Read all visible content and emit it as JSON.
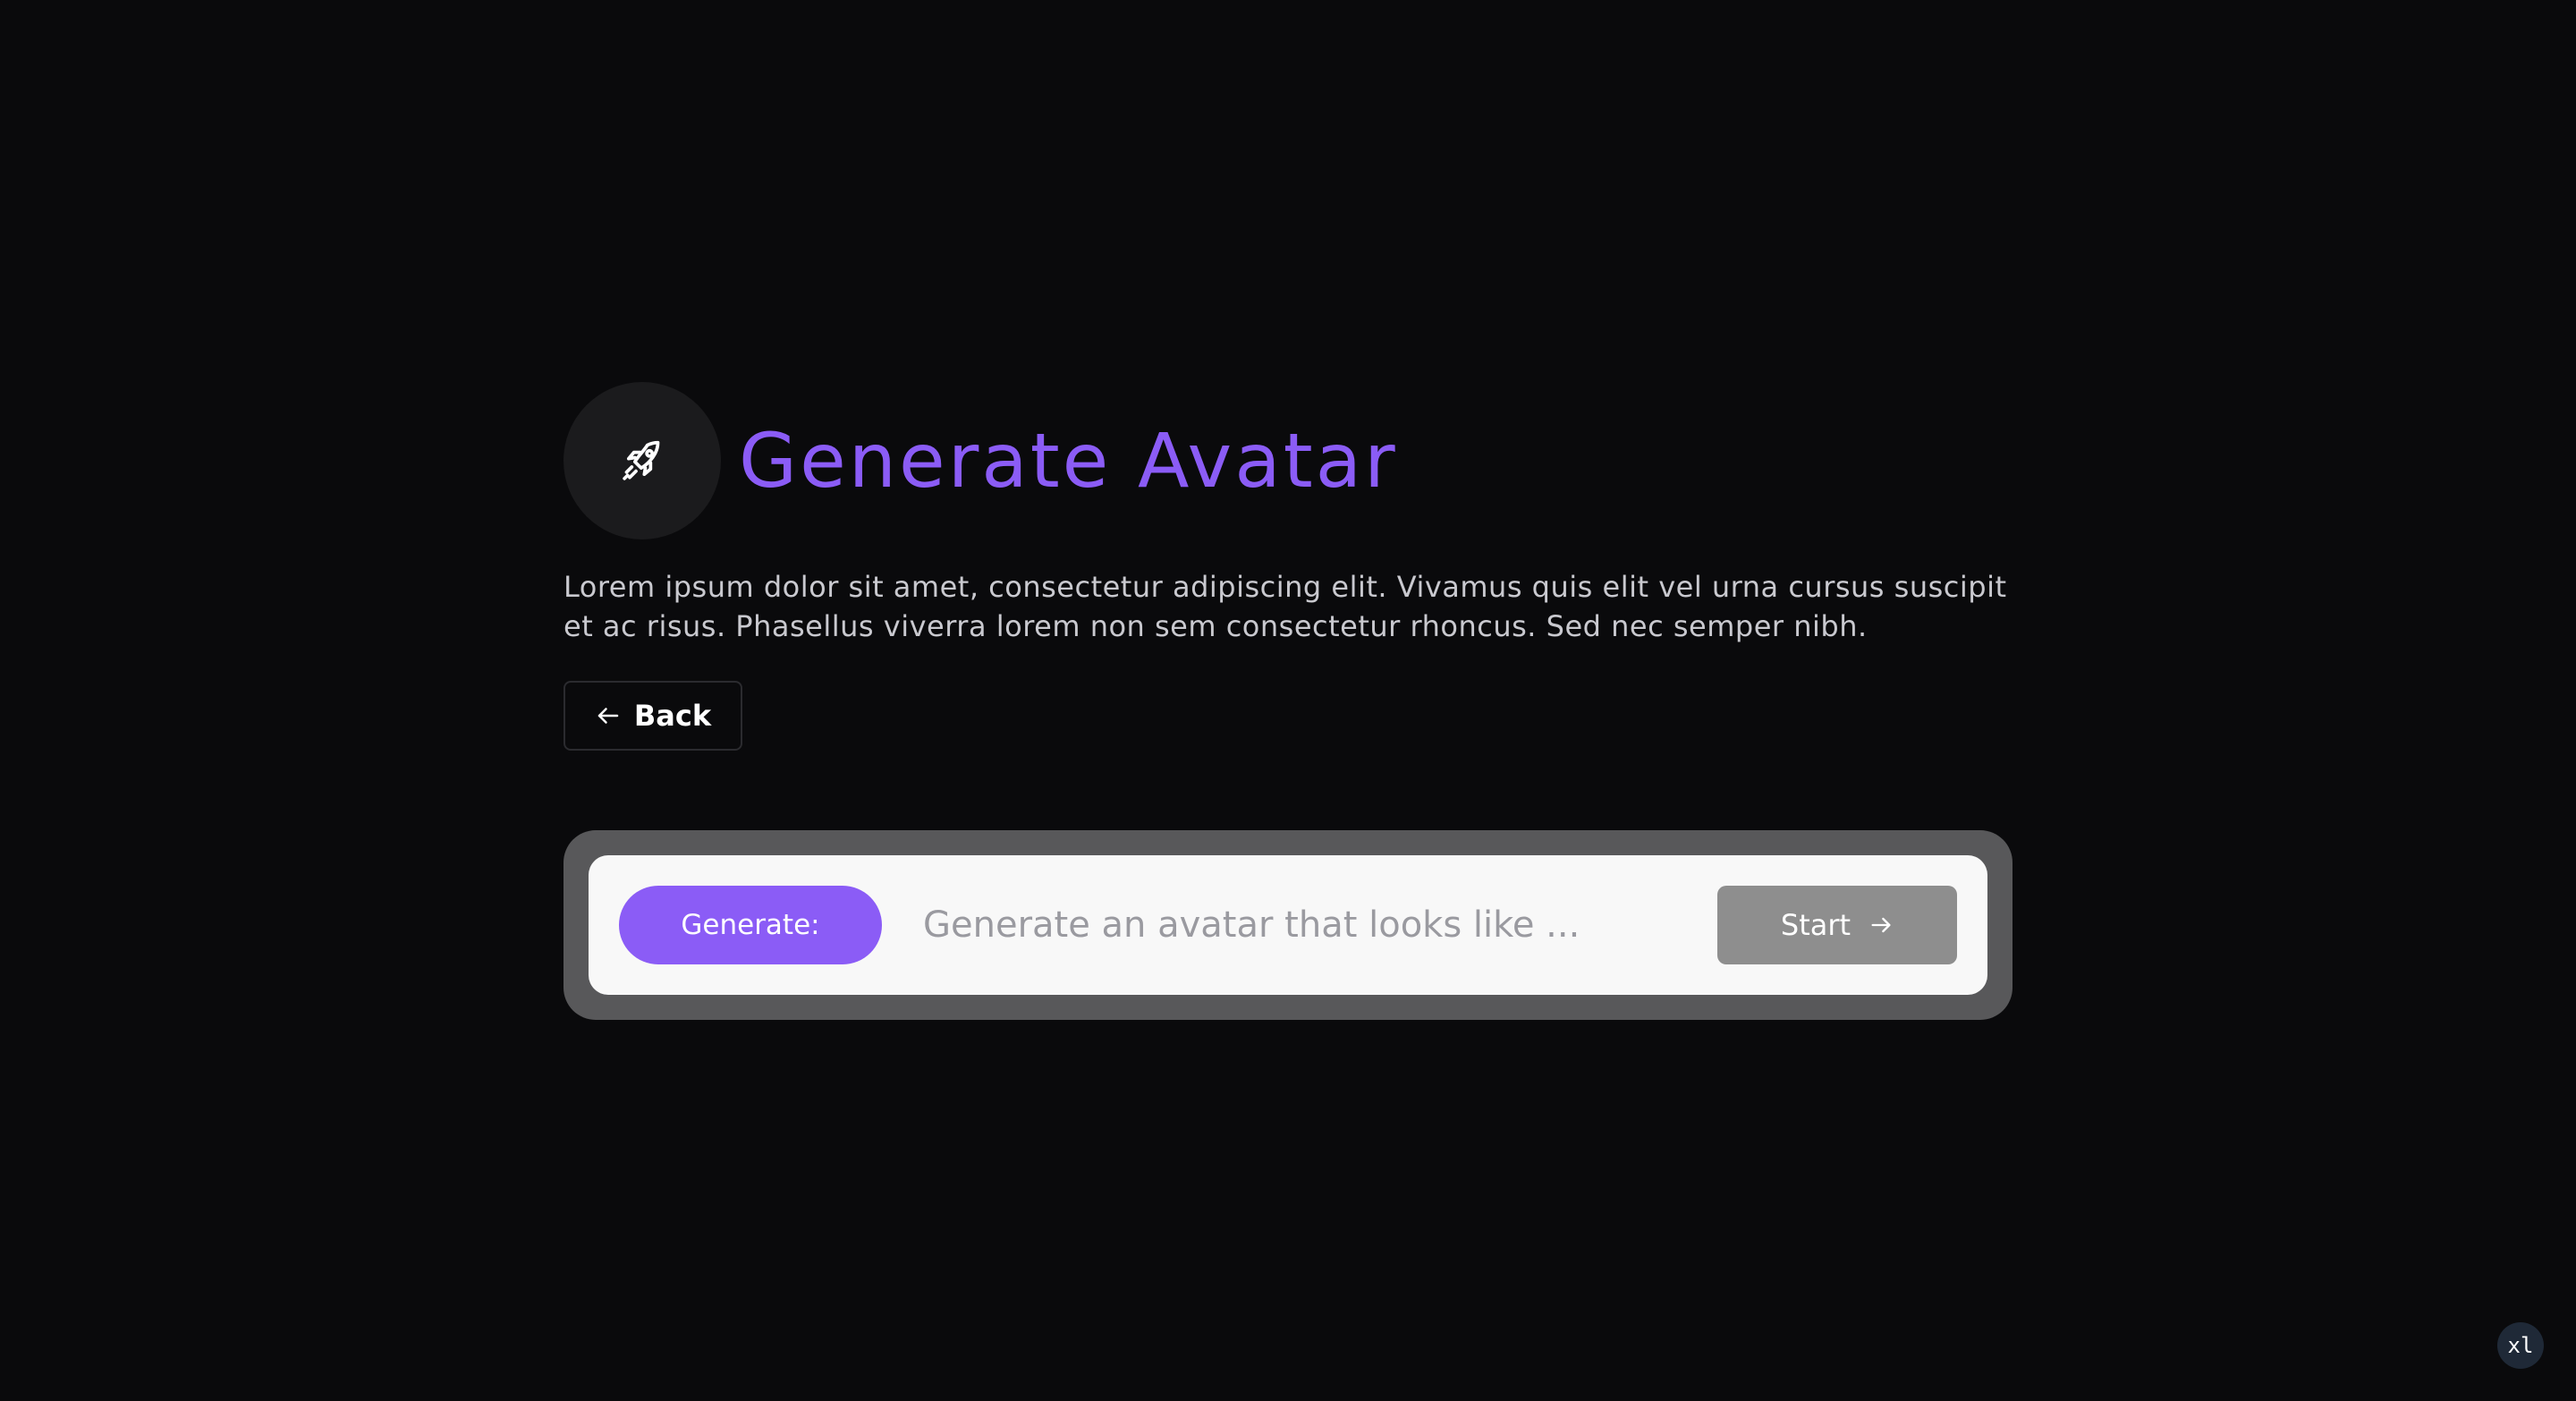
{
  "header": {
    "icon": "rocket-icon",
    "title": "Generate Avatar"
  },
  "description": "Lorem ipsum dolor sit amet, consectetur adipiscing elit. Vivamus quis elit vel urna cursus suscipit et ac risus. Phasellus viverra lorem non sem consectetur rhoncus. Sed nec semper nibh.",
  "back_button": {
    "icon": "arrow-left-icon",
    "label": "Back"
  },
  "prompt": {
    "generate_label": "Generate:",
    "input_value": "",
    "input_placeholder": "Generate an avatar that looks like ...",
    "start_label": "Start",
    "start_icon": "arrow-right-icon"
  },
  "badge": {
    "label": "xl"
  },
  "colors": {
    "accent": "#8b5cf6",
    "background": "#0a0a0c",
    "start_button": "#8e8e8e"
  }
}
